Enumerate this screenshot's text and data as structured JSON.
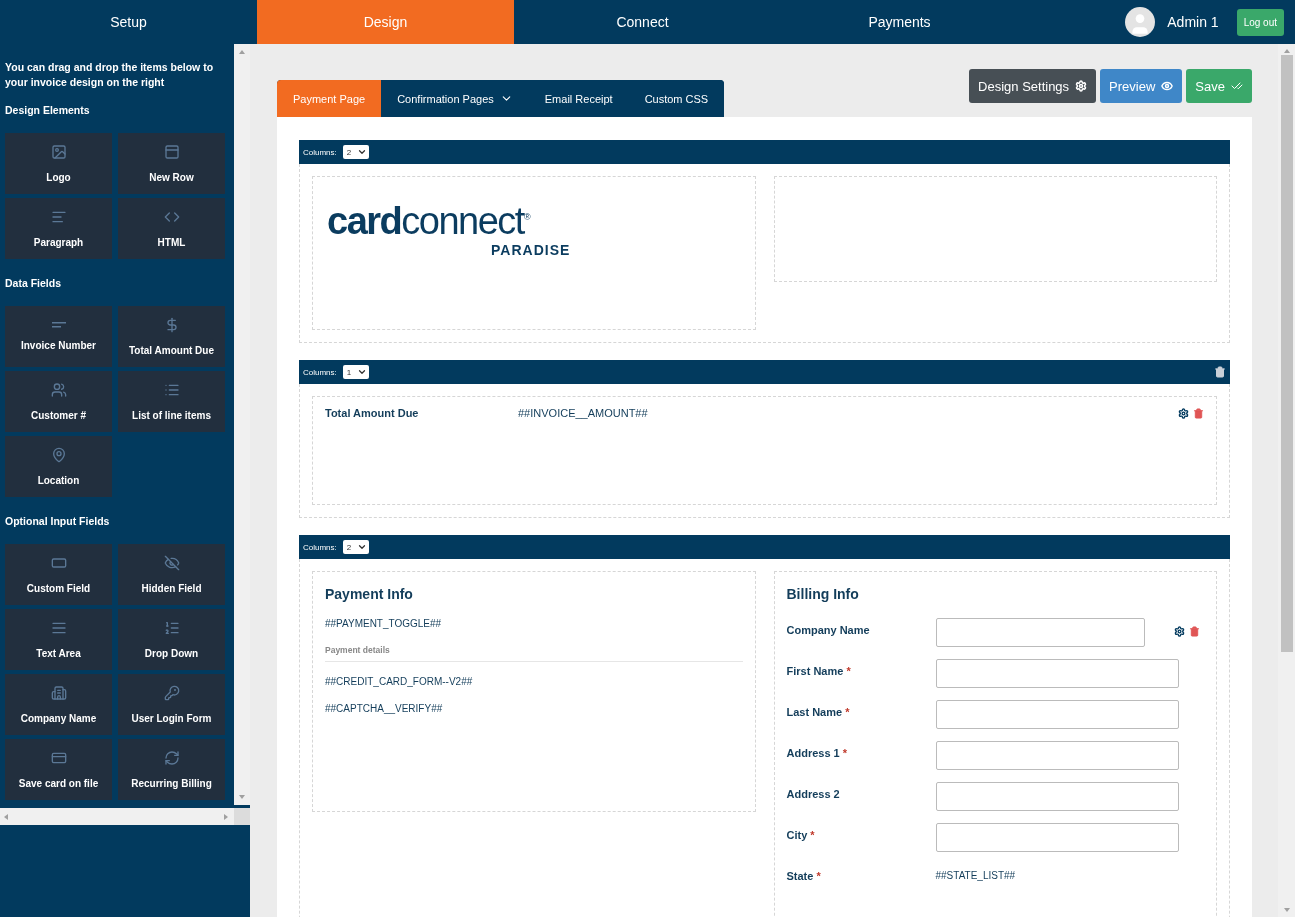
{
  "nav": {
    "tabs": [
      {
        "label": "Setup",
        "selected": false
      },
      {
        "label": "Design",
        "selected": true
      },
      {
        "label": "Connect",
        "selected": false
      },
      {
        "label": "Payments",
        "selected": false
      }
    ],
    "user": "Admin 1",
    "logout": "Log out"
  },
  "sidebar": {
    "intro": "You can drag and drop the items below to your invoice design on the right",
    "groups": [
      {
        "title": "Design Elements",
        "items": [
          "Logo",
          "New Row",
          "Paragraph",
          "HTML"
        ]
      },
      {
        "title": "Data Fields",
        "items": [
          "Invoice Number",
          "Total Amount Due",
          "Customer #",
          "List of line items",
          "Location"
        ]
      },
      {
        "title": "Optional Input Fields",
        "items": [
          "Custom Field",
          "Hidden Field",
          "Text Area",
          "Drop Down",
          "Company Name",
          "User Login Form",
          "Save card on file",
          "Recurring Billing"
        ]
      }
    ]
  },
  "page_tabs": [
    {
      "label": "Payment Page",
      "selected": true,
      "has_menu": false
    },
    {
      "label": "Confirmation Pages",
      "selected": false,
      "has_menu": true
    },
    {
      "label": "Email Receipt",
      "selected": false,
      "has_menu": false
    },
    {
      "label": "Custom CSS",
      "selected": false,
      "has_menu": false
    }
  ],
  "actions": [
    {
      "label": "Design Settings",
      "kind": "settings"
    },
    {
      "label": "Preview",
      "kind": "preview"
    },
    {
      "label": "Save",
      "kind": "save"
    }
  ],
  "sections": [
    {
      "kind": "logo",
      "columns_label": "Columns:",
      "columns": "2",
      "deletable": false,
      "logo": {
        "wordmark": "**card**connect$^{®}$",
        "sub": "PARADISE"
      }
    },
    {
      "kind": "fields",
      "columns_label": "Columns:",
      "columns": "1",
      "deletable": true,
      "rows": [
        {
          "label": "Total Amount Due",
          "value": "##INVOICE__AMOUNT##",
          "hovered": true
        }
      ]
    },
    {
      "kind": "forms",
      "columns_label": "Columns:",
      "columns": "2",
      "deletable": false,
      "payment": {
        "title": "Payment Info",
        "toggle": "##PAYMENT_TOGGLE##",
        "details_label": "Payment details",
        "tokens": [
          "##CREDIT_CARD_FORM--V2##",
          "##CAPTCHA__VERIFY##"
        ]
      },
      "billing": {
        "title": "Billing Info",
        "required_mark": "*",
        "fields": [
          {
            "label": "Company Name",
            "required": false,
            "kind": "input",
            "hovered": true
          },
          {
            "label": "First Name",
            "required": true,
            "kind": "input",
            "hovered": false
          },
          {
            "label": "Last Name",
            "required": true,
            "kind": "input",
            "hovered": false
          },
          {
            "label": "Address 1",
            "required": true,
            "kind": "input",
            "hovered": false
          },
          {
            "label": "Address 2",
            "required": false,
            "kind": "input",
            "hovered": false
          },
          {
            "label": "City",
            "required": true,
            "kind": "input",
            "hovered": false
          },
          {
            "label": "State",
            "required": true,
            "kind": "token",
            "value": "##STATE_LIST##",
            "hovered": false
          }
        ]
      }
    }
  ]
}
